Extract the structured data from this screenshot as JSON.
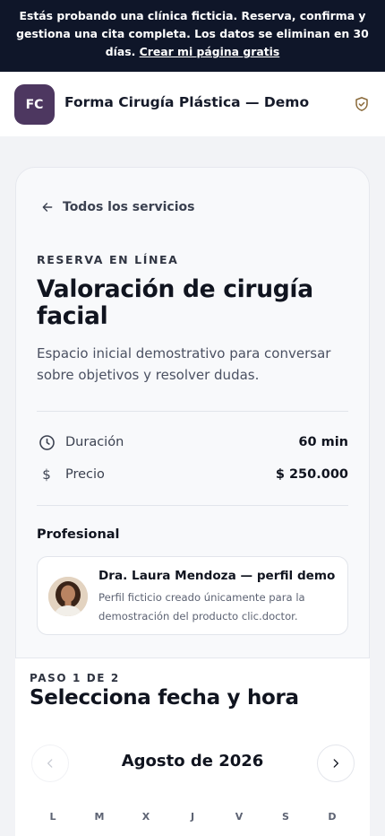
{
  "banner": {
    "text": "Estás probando una clínica ficticia. Reserva, confirma y gestiona una cita completa. Los datos se eliminan en 30 días.",
    "link": "Crear mi página gratis"
  },
  "header": {
    "logo_initials": "FC",
    "clinic_name": "Forma Cirugía Plástica — Demo",
    "verified_icon": "shield-check-icon"
  },
  "service": {
    "back_label": "Todos los servicios",
    "eyebrow": "RESERVA EN LÍNEA",
    "title": "Valoración de cirugía facial",
    "description": "Espacio inicial demostrativo para conversar sobre objetivos y resolver dudas.",
    "details": [
      {
        "icon": "clock-icon",
        "label": "Duración",
        "value": "60 min"
      },
      {
        "icon": "dollar-icon",
        "label": "Precio",
        "value": "$ 250.000"
      }
    ]
  },
  "professional": {
    "section_label": "Profesional",
    "name": "Dra. Laura Mendoza — perfil demo",
    "description": "Perfil ficticio creado únicamente para la demostración del producto clic.doctor."
  },
  "booking": {
    "step": "PASO 1 DE 2",
    "title": "Selecciona fecha y hora",
    "month": "Agosto de 2026",
    "weekdays": [
      "L",
      "M",
      "X",
      "J",
      "V",
      "S",
      "D"
    ]
  },
  "colors": {
    "banner_bg": "#0f1629",
    "logo_bg": "#4d3760",
    "accent_shield": "#8a6a3a"
  }
}
